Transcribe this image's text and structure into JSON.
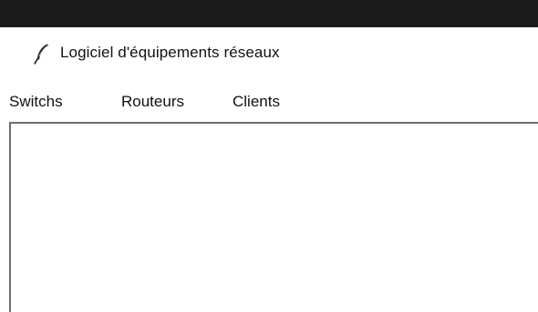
{
  "window": {
    "title": "Logiciel d'équipements réseaux",
    "icon": "feather-icon"
  },
  "menubar": {
    "items": [
      {
        "label": "Switchs"
      },
      {
        "label": "Routeurs"
      },
      {
        "label": "Clients"
      }
    ]
  },
  "colors": {
    "top_strip": "#1b1b1b",
    "window_bg": "#ffffff",
    "border": "#6d6d6d",
    "text": "#111111"
  }
}
